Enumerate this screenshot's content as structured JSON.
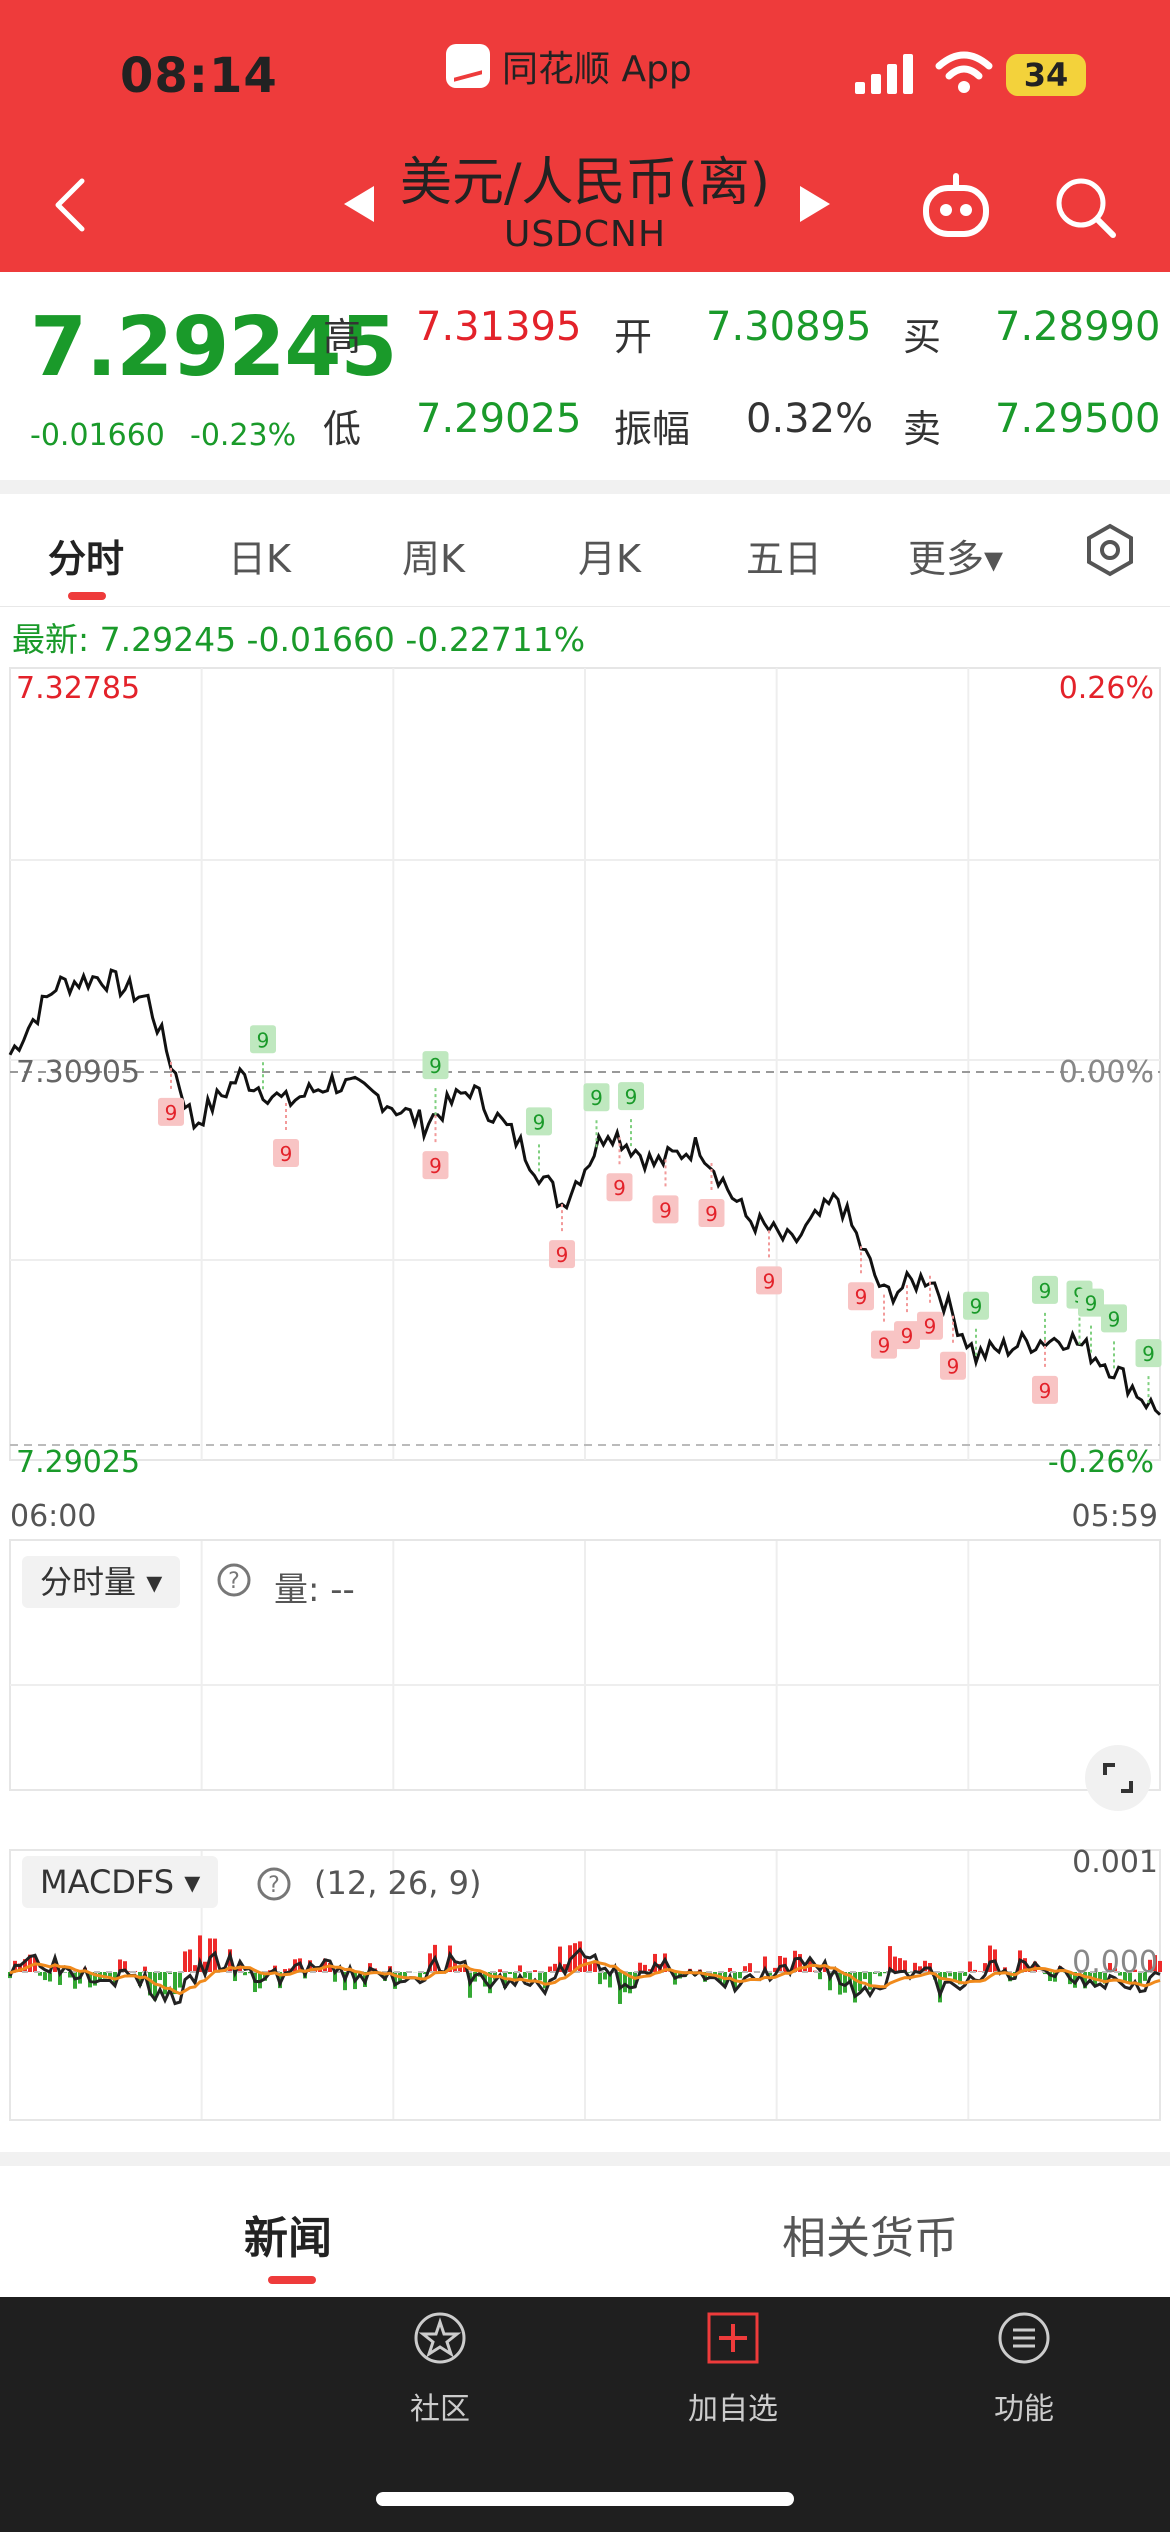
{
  "status_bar": {
    "time": "08:14",
    "app_name": "同花顺 App",
    "battery": "34"
  },
  "header": {
    "title": "美元/人民币(离)",
    "code": "USDCNH"
  },
  "quote": {
    "last": "7.29245",
    "change": "-0.01660",
    "change_pct": "-0.23%",
    "high_label": "高",
    "high": "7.31395",
    "open_label": "开",
    "open": "7.30895",
    "bid_label": "买",
    "bid": "7.28990",
    "low_label": "低",
    "low": "7.29025",
    "amp_label": "振幅",
    "amp": "0.32%",
    "ask_label": "卖",
    "ask": "7.29500"
  },
  "tabs": [
    "分时",
    "日K",
    "周K",
    "月K",
    "五日",
    "更多▾"
  ],
  "latest_line": "最新: 7.29245  -0.01660  -0.22711%",
  "chart_data": {
    "type": "line",
    "series": "intraday",
    "ylim": [
      7.29025,
      7.32785
    ],
    "prev_close": 7.30905,
    "y_labels": {
      "top": "7.32785",
      "mid": "7.30905",
      "bottom": "7.29025",
      "top_pct": "0.26%",
      "mid_pct": "0.00%",
      "bottom_pct": "-0.26%"
    },
    "x_labels": {
      "start": "06:00",
      "end": "05:59"
    },
    "x": [
      0,
      4,
      8,
      12,
      16,
      20,
      24,
      28,
      32,
      36,
      40,
      44,
      48,
      52,
      56,
      60,
      64,
      68,
      72,
      76,
      80,
      84,
      88,
      92,
      96,
      100
    ],
    "y": [
      7.3095,
      7.3128,
      7.3132,
      7.3121,
      7.3062,
      7.3085,
      7.3072,
      7.3082,
      7.3075,
      7.3062,
      7.3079,
      7.3055,
      7.3024,
      7.306,
      7.3043,
      7.3052,
      7.3018,
      7.3005,
      7.3027,
      7.2981,
      7.299,
      7.2952,
      7.2958,
      7.2961,
      7.2946,
      7.2924
    ],
    "td9_green_x": [
      22,
      37,
      46,
      51,
      54,
      84,
      90,
      93,
      94,
      96,
      99
    ],
    "td9_red_x": [
      14,
      24,
      37,
      48,
      53,
      57,
      61,
      66,
      74,
      76,
      78,
      80,
      82,
      90
    ],
    "volume": {
      "selector": "分时量",
      "label": "量: --"
    },
    "macd": {
      "selector": "MACDFS",
      "params": "(12, 26, 9)",
      "top_label": "0.001",
      "zero_label": "0.000"
    }
  },
  "bottom_tabs": {
    "news": "新闻",
    "related": "相关货币"
  },
  "bottom_bar": [
    {
      "label": "社区"
    },
    {
      "label": "加自选"
    },
    {
      "label": "功能"
    }
  ]
}
